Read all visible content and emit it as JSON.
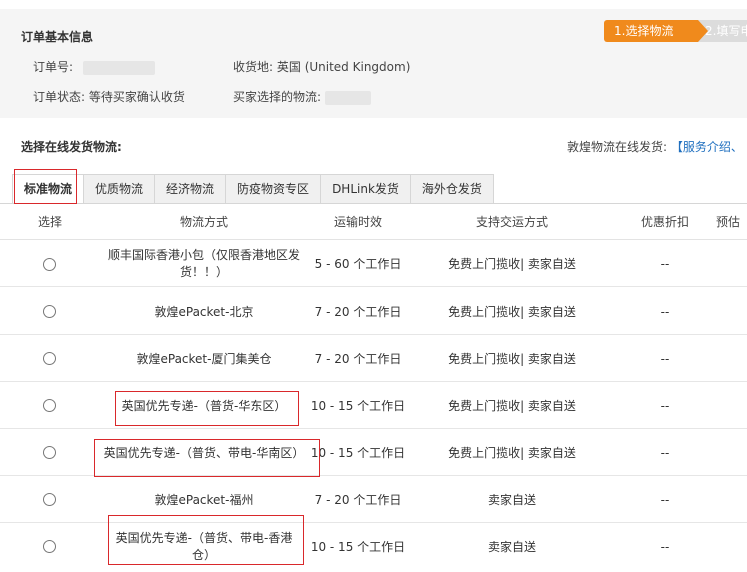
{
  "order": {
    "title": "订单基本信息",
    "order_no_label": "订单号:",
    "order_status_label": "订单状态:",
    "order_status_value": "等待买家确认收货",
    "ship_to_label": "收货地:",
    "ship_to_value": "英国 (United Kingdom)",
    "buyer_logistics_label": "买家选择的物流:"
  },
  "steps": [
    {
      "label": "1.选择物流"
    },
    {
      "label": "2.填写申"
    }
  ],
  "section": {
    "title": "选择在线发货物流:",
    "right_text": "敦煌物流在线发货:",
    "right_link": "【服务介绍、"
  },
  "tabs": [
    {
      "label": "标准物流"
    },
    {
      "label": "优质物流"
    },
    {
      "label": "经济物流"
    },
    {
      "label": "防疫物资专区"
    },
    {
      "label": "DHLink发货"
    },
    {
      "label": "海外仓发货"
    }
  ],
  "table": {
    "headers": [
      "选择",
      "物流方式",
      "运输时效",
      "支持交运方式",
      "优惠折扣",
      "预估"
    ],
    "rows": [
      {
        "method": "顺丰国际香港小包（仅限香港地区发货！！）",
        "time": "5 - 60 个工作日",
        "ways": "免费上门揽收| 卖家自送",
        "discount": "--"
      },
      {
        "method": "敦煌ePacket-北京",
        "time": "7 - 20 个工作日",
        "ways": "免费上门揽收| 卖家自送",
        "discount": "--"
      },
      {
        "method": "敦煌ePacket-厦门集美仓",
        "time": "7 - 20 个工作日",
        "ways": "免费上门揽收| 卖家自送",
        "discount": "--"
      },
      {
        "method": "英国优先专递-（普货-华东区）",
        "time": "10 - 15 个工作日",
        "ways": "免费上门揽收| 卖家自送",
        "discount": "--"
      },
      {
        "method": "英国优先专递-（普货、带电-华南区）",
        "time": "10 - 15 个工作日",
        "ways": "免费上门揽收| 卖家自送",
        "discount": "--"
      },
      {
        "method": "敦煌ePacket-福州",
        "time": "7 - 20 个工作日",
        "ways": "卖家自送",
        "discount": "--"
      },
      {
        "method": "英国优先专递-（普货、带电-香港仓）",
        "time": "10 - 15 个工作日",
        "ways": "卖家自送",
        "discount": "--"
      }
    ]
  },
  "colors": {
    "accent": "#f08a1c",
    "highlight_border": "#d9282b",
    "link": "#1f6fbf"
  }
}
